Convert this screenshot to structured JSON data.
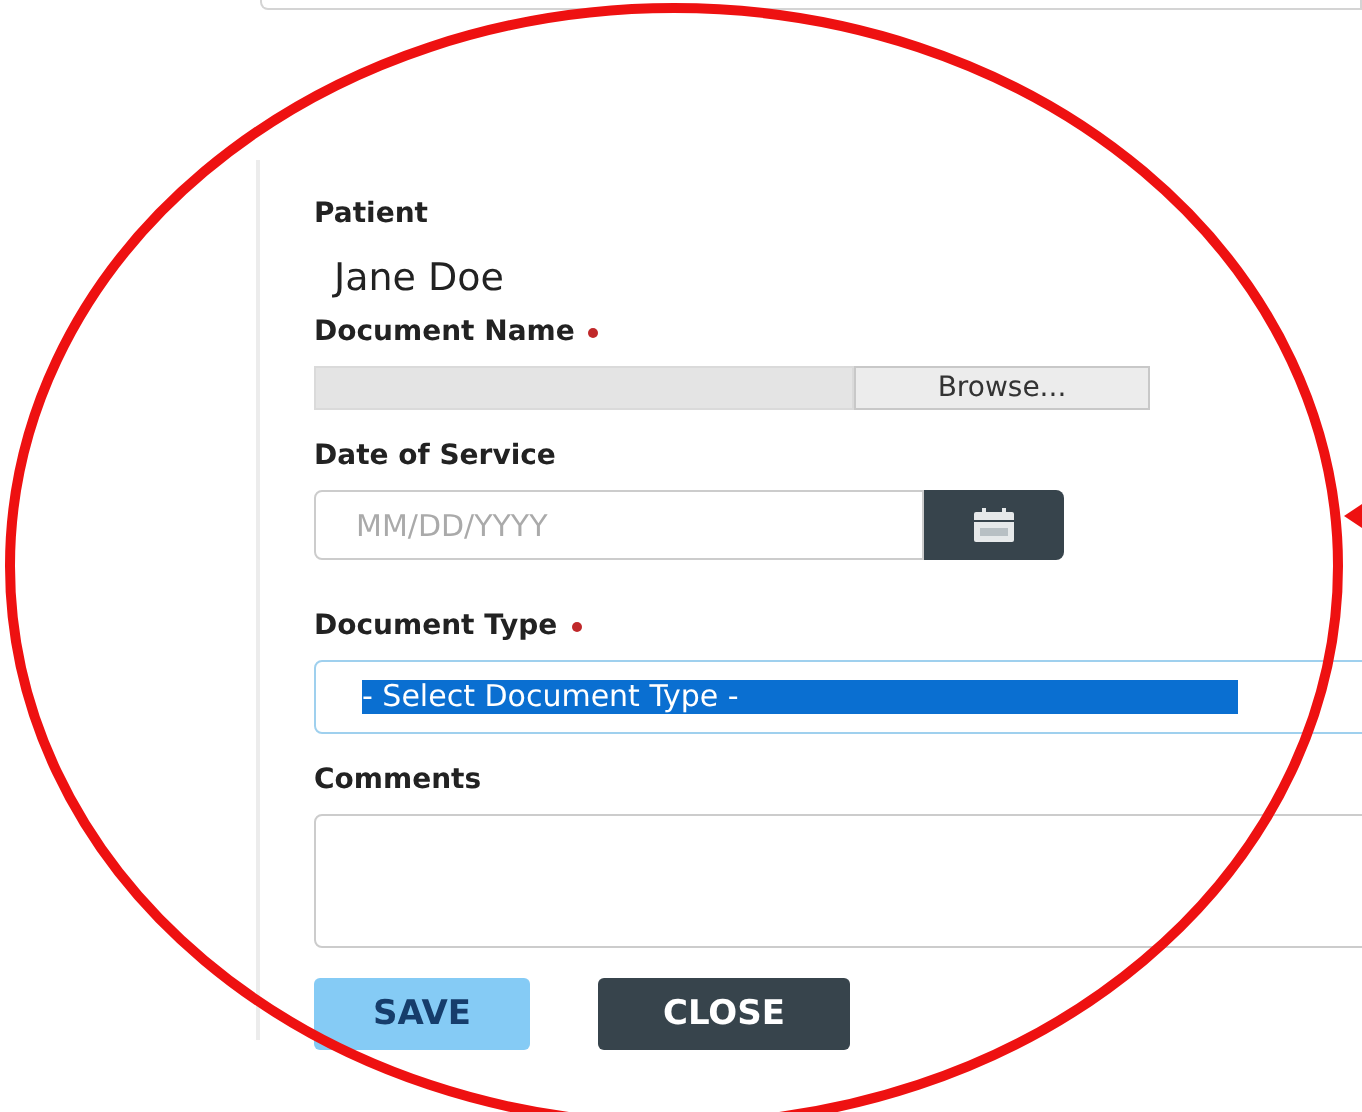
{
  "patient": {
    "label": "Patient",
    "value": "Jane Doe"
  },
  "document_name": {
    "label": "Document Name",
    "required": true,
    "browse_button": "Browse..."
  },
  "date_of_service": {
    "label": "Date of Service",
    "placeholder": "MM/DD/YYYY"
  },
  "document_type": {
    "label": "Document Type",
    "required": true,
    "value": "- Select Document Type -",
    "highlighted": true
  },
  "comments": {
    "label": "Comments"
  },
  "buttons": [
    {
      "label": "SAVE",
      "kind": "primary"
    },
    {
      "label": "CLOSE",
      "kind": "secondary"
    }
  ]
}
